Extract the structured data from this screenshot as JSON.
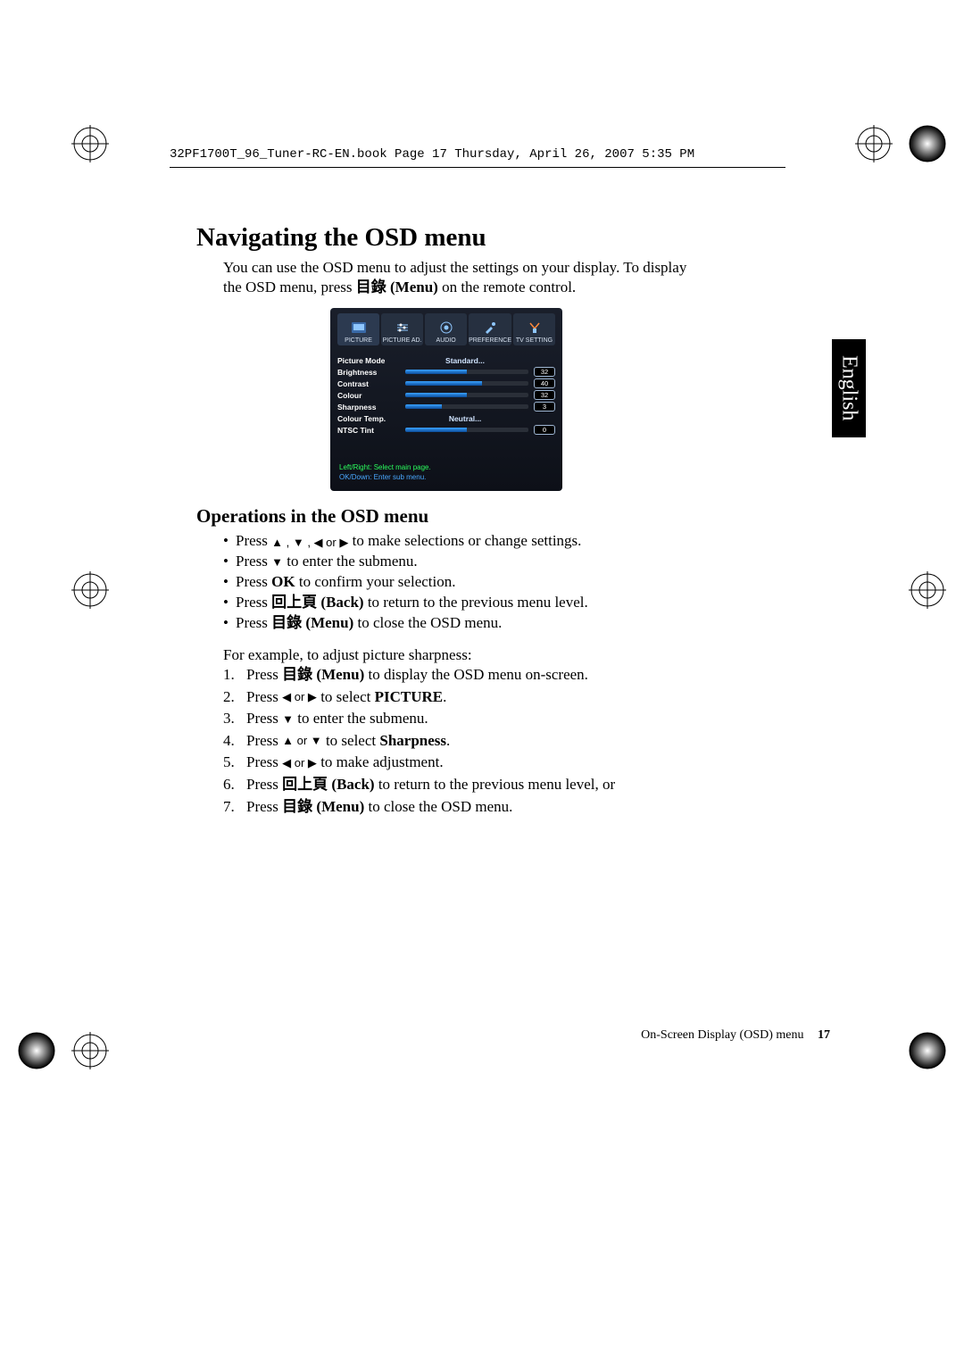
{
  "running_head": "32PF1700T_96_Tuner-RC-EN.book  Page 17  Thursday, April 26, 2007  5:35 PM",
  "language_tab": "English",
  "h1": "Navigating the OSD menu",
  "intro_a": "You can use the OSD menu to adjust the settings on your display. To display the OSD menu, press ",
  "intro_menu_cjk": "目錄",
  "intro_menu_en": " (Menu)",
  "intro_b": " on the remote control.",
  "osd": {
    "tabs": [
      "PICTURE",
      "PICTURE AD.",
      "AUDIO",
      "PREFERENCE",
      "TV SETTING"
    ],
    "rows": [
      {
        "label": "Picture Mode",
        "value": "Standard...",
        "type": "text"
      },
      {
        "label": "Brightness",
        "type": "bar",
        "num": "32",
        "fill": 50
      },
      {
        "label": "Contrast",
        "type": "bar",
        "num": "40",
        "fill": 62
      },
      {
        "label": "Colour",
        "type": "bar",
        "num": "32",
        "fill": 50
      },
      {
        "label": "Sharpness",
        "type": "bar",
        "num": "3",
        "fill": 30
      },
      {
        "label": "Colour Temp.",
        "value": "Neutral...",
        "type": "text"
      },
      {
        "label": "NTSC Tint",
        "type": "bar",
        "num": "0",
        "fill": 50
      }
    ],
    "hint1": "Left/Right: Select main page.",
    "hint2": "OK/Down: Enter sub menu."
  },
  "h2": "Operations in the OSD menu",
  "ops": [
    {
      "pre": "Press ",
      "arrows": "▲ , ▼ , ◀ or ▶",
      "post": " to make selections or change settings."
    },
    {
      "pre": "Press ",
      "arrows": "▼",
      "post": " to enter the submenu."
    },
    {
      "pre": "Press ",
      "bold": "OK",
      "post": " to confirm your selection."
    },
    {
      "pre": "Press ",
      "cjk": "回上頁",
      "bold": " (Back)",
      "post": " to return to the previous menu level."
    },
    {
      "pre": "Press ",
      "cjk": "目錄",
      "bold": " (Menu)",
      "post": " to close the OSD menu."
    }
  ],
  "example_lead": "For example, to adjust picture sharpness:",
  "steps": [
    {
      "pre": "Press ",
      "cjk": "目錄",
      "bold": " (Menu)",
      "post": " to display the OSD menu on-screen."
    },
    {
      "pre": "Press ",
      "arrows": "◀ or ▶",
      "post_pre": " to select ",
      "bold2": "PICTURE",
      "post": "."
    },
    {
      "pre": "Press ",
      "arrows": "▼",
      "post": " to enter the submenu."
    },
    {
      "pre": "Press ",
      "arrows": "▲ or ▼",
      "post_pre": " to select ",
      "bold2": "Sharpness",
      "post": "."
    },
    {
      "pre": "Press ",
      "arrows": "◀ or ▶",
      "post": " to make adjustment."
    },
    {
      "pre": "Press ",
      "cjk": "回上頁",
      "bold": " (Back)",
      "post": " to return to the previous menu level, or"
    },
    {
      "pre": "Press ",
      "cjk": "目錄",
      "bold": " (Menu)",
      "post": " to close the OSD menu."
    }
  ],
  "footer_section": "On-Screen Display (OSD) menu",
  "footer_page": "17"
}
